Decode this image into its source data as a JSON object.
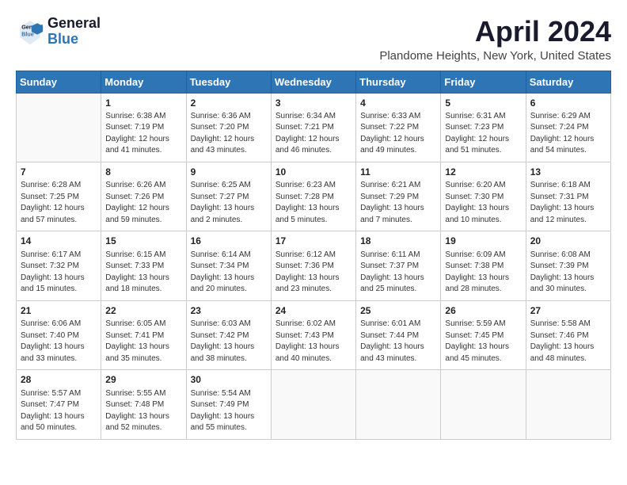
{
  "logo": {
    "line1": "General",
    "line2": "Blue"
  },
  "title": "April 2024",
  "location": "Plandome Heights, New York, United States",
  "days_header": [
    "Sunday",
    "Monday",
    "Tuesday",
    "Wednesday",
    "Thursday",
    "Friday",
    "Saturday"
  ],
  "weeks": [
    [
      {
        "num": "",
        "sunrise": "",
        "sunset": "",
        "daylight": ""
      },
      {
        "num": "1",
        "sunrise": "Sunrise: 6:38 AM",
        "sunset": "Sunset: 7:19 PM",
        "daylight": "Daylight: 12 hours and 41 minutes."
      },
      {
        "num": "2",
        "sunrise": "Sunrise: 6:36 AM",
        "sunset": "Sunset: 7:20 PM",
        "daylight": "Daylight: 12 hours and 43 minutes."
      },
      {
        "num": "3",
        "sunrise": "Sunrise: 6:34 AM",
        "sunset": "Sunset: 7:21 PM",
        "daylight": "Daylight: 12 hours and 46 minutes."
      },
      {
        "num": "4",
        "sunrise": "Sunrise: 6:33 AM",
        "sunset": "Sunset: 7:22 PM",
        "daylight": "Daylight: 12 hours and 49 minutes."
      },
      {
        "num": "5",
        "sunrise": "Sunrise: 6:31 AM",
        "sunset": "Sunset: 7:23 PM",
        "daylight": "Daylight: 12 hours and 51 minutes."
      },
      {
        "num": "6",
        "sunrise": "Sunrise: 6:29 AM",
        "sunset": "Sunset: 7:24 PM",
        "daylight": "Daylight: 12 hours and 54 minutes."
      }
    ],
    [
      {
        "num": "7",
        "sunrise": "Sunrise: 6:28 AM",
        "sunset": "Sunset: 7:25 PM",
        "daylight": "Daylight: 12 hours and 57 minutes."
      },
      {
        "num": "8",
        "sunrise": "Sunrise: 6:26 AM",
        "sunset": "Sunset: 7:26 PM",
        "daylight": "Daylight: 12 hours and 59 minutes."
      },
      {
        "num": "9",
        "sunrise": "Sunrise: 6:25 AM",
        "sunset": "Sunset: 7:27 PM",
        "daylight": "Daylight: 13 hours and 2 minutes."
      },
      {
        "num": "10",
        "sunrise": "Sunrise: 6:23 AM",
        "sunset": "Sunset: 7:28 PM",
        "daylight": "Daylight: 13 hours and 5 minutes."
      },
      {
        "num": "11",
        "sunrise": "Sunrise: 6:21 AM",
        "sunset": "Sunset: 7:29 PM",
        "daylight": "Daylight: 13 hours and 7 minutes."
      },
      {
        "num": "12",
        "sunrise": "Sunrise: 6:20 AM",
        "sunset": "Sunset: 7:30 PM",
        "daylight": "Daylight: 13 hours and 10 minutes."
      },
      {
        "num": "13",
        "sunrise": "Sunrise: 6:18 AM",
        "sunset": "Sunset: 7:31 PM",
        "daylight": "Daylight: 13 hours and 12 minutes."
      }
    ],
    [
      {
        "num": "14",
        "sunrise": "Sunrise: 6:17 AM",
        "sunset": "Sunset: 7:32 PM",
        "daylight": "Daylight: 13 hours and 15 minutes."
      },
      {
        "num": "15",
        "sunrise": "Sunrise: 6:15 AM",
        "sunset": "Sunset: 7:33 PM",
        "daylight": "Daylight: 13 hours and 18 minutes."
      },
      {
        "num": "16",
        "sunrise": "Sunrise: 6:14 AM",
        "sunset": "Sunset: 7:34 PM",
        "daylight": "Daylight: 13 hours and 20 minutes."
      },
      {
        "num": "17",
        "sunrise": "Sunrise: 6:12 AM",
        "sunset": "Sunset: 7:36 PM",
        "daylight": "Daylight: 13 hours and 23 minutes."
      },
      {
        "num": "18",
        "sunrise": "Sunrise: 6:11 AM",
        "sunset": "Sunset: 7:37 PM",
        "daylight": "Daylight: 13 hours and 25 minutes."
      },
      {
        "num": "19",
        "sunrise": "Sunrise: 6:09 AM",
        "sunset": "Sunset: 7:38 PM",
        "daylight": "Daylight: 13 hours and 28 minutes."
      },
      {
        "num": "20",
        "sunrise": "Sunrise: 6:08 AM",
        "sunset": "Sunset: 7:39 PM",
        "daylight": "Daylight: 13 hours and 30 minutes."
      }
    ],
    [
      {
        "num": "21",
        "sunrise": "Sunrise: 6:06 AM",
        "sunset": "Sunset: 7:40 PM",
        "daylight": "Daylight: 13 hours and 33 minutes."
      },
      {
        "num": "22",
        "sunrise": "Sunrise: 6:05 AM",
        "sunset": "Sunset: 7:41 PM",
        "daylight": "Daylight: 13 hours and 35 minutes."
      },
      {
        "num": "23",
        "sunrise": "Sunrise: 6:03 AM",
        "sunset": "Sunset: 7:42 PM",
        "daylight": "Daylight: 13 hours and 38 minutes."
      },
      {
        "num": "24",
        "sunrise": "Sunrise: 6:02 AM",
        "sunset": "Sunset: 7:43 PM",
        "daylight": "Daylight: 13 hours and 40 minutes."
      },
      {
        "num": "25",
        "sunrise": "Sunrise: 6:01 AM",
        "sunset": "Sunset: 7:44 PM",
        "daylight": "Daylight: 13 hours and 43 minutes."
      },
      {
        "num": "26",
        "sunrise": "Sunrise: 5:59 AM",
        "sunset": "Sunset: 7:45 PM",
        "daylight": "Daylight: 13 hours and 45 minutes."
      },
      {
        "num": "27",
        "sunrise": "Sunrise: 5:58 AM",
        "sunset": "Sunset: 7:46 PM",
        "daylight": "Daylight: 13 hours and 48 minutes."
      }
    ],
    [
      {
        "num": "28",
        "sunrise": "Sunrise: 5:57 AM",
        "sunset": "Sunset: 7:47 PM",
        "daylight": "Daylight: 13 hours and 50 minutes."
      },
      {
        "num": "29",
        "sunrise": "Sunrise: 5:55 AM",
        "sunset": "Sunset: 7:48 PM",
        "daylight": "Daylight: 13 hours and 52 minutes."
      },
      {
        "num": "30",
        "sunrise": "Sunrise: 5:54 AM",
        "sunset": "Sunset: 7:49 PM",
        "daylight": "Daylight: 13 hours and 55 minutes."
      },
      {
        "num": "",
        "sunrise": "",
        "sunset": "",
        "daylight": ""
      },
      {
        "num": "",
        "sunrise": "",
        "sunset": "",
        "daylight": ""
      },
      {
        "num": "",
        "sunrise": "",
        "sunset": "",
        "daylight": ""
      },
      {
        "num": "",
        "sunrise": "",
        "sunset": "",
        "daylight": ""
      }
    ]
  ]
}
